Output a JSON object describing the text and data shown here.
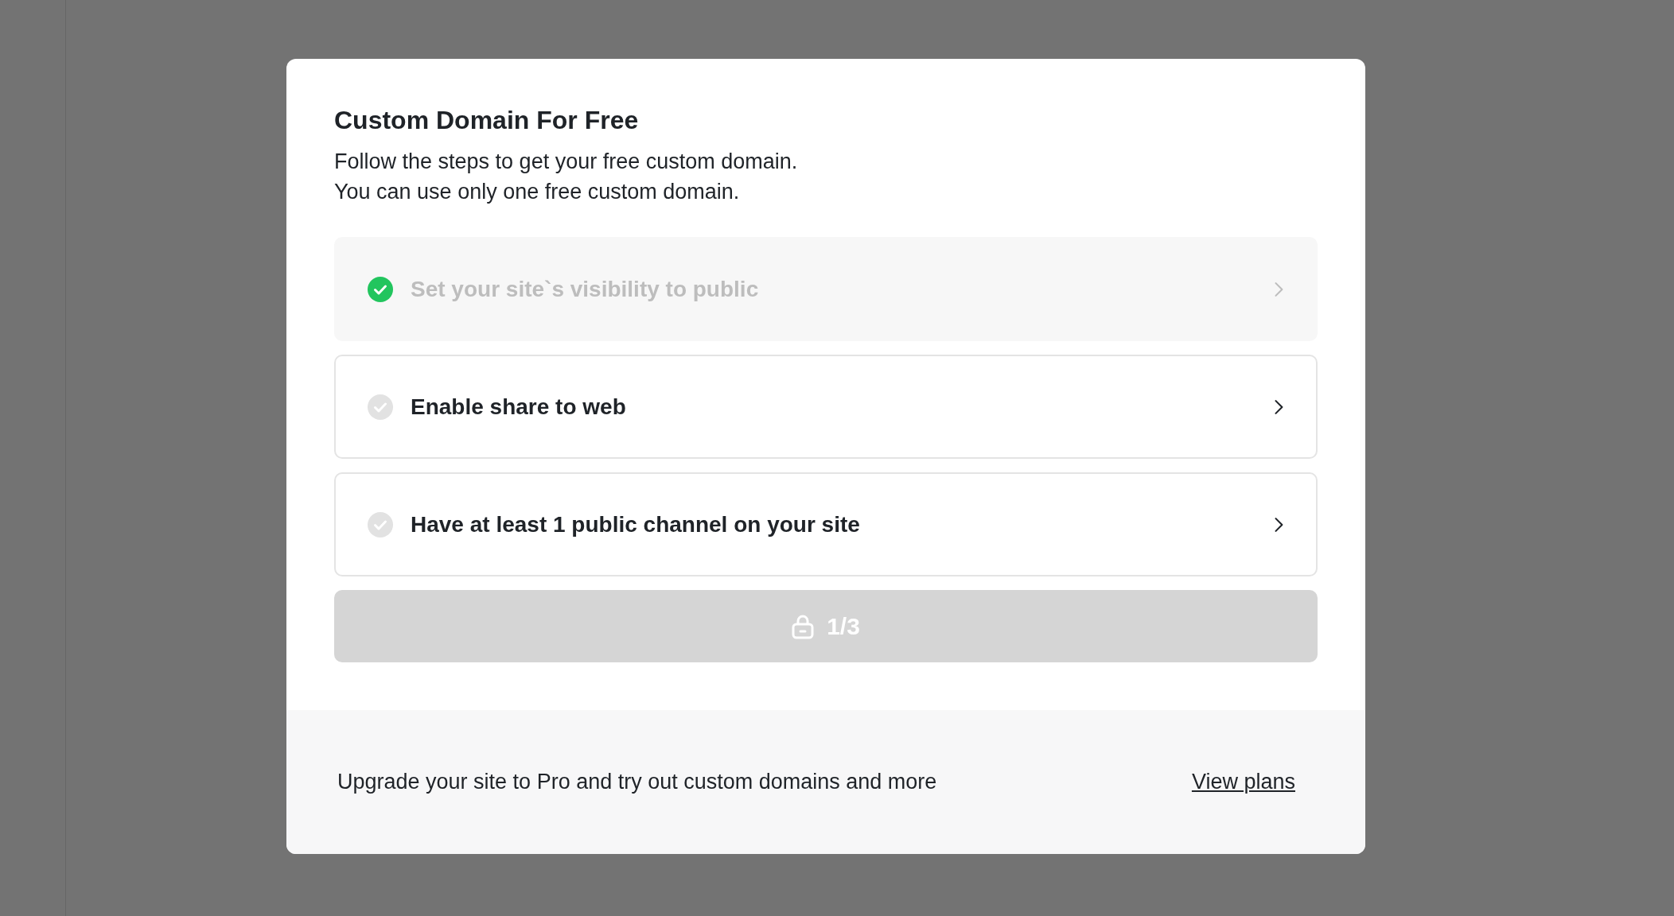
{
  "dialog": {
    "title": "Custom Domain For Free",
    "description": [
      "Follow the steps to get your free custom domain.",
      "You can use only one free custom domain."
    ],
    "steps": [
      {
        "label": "Set your site`s visibility to public",
        "done": true
      },
      {
        "label": "Enable share to web",
        "done": false
      },
      {
        "label": "Have at least 1 public channel on your site",
        "done": false
      }
    ],
    "claim_button": {
      "label": "1/3",
      "disabled": true
    },
    "footer": {
      "text": "Upgrade your site to Pro and try out custom domains and more",
      "link": "View plans"
    }
  }
}
